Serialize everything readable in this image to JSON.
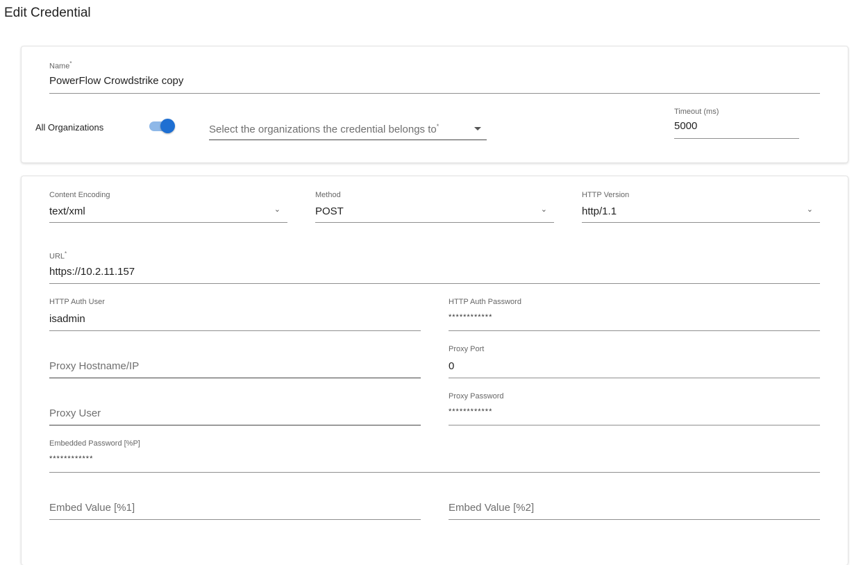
{
  "page": {
    "title": "Edit Credential"
  },
  "general": {
    "name": {
      "label": "Name",
      "required_mark": "*",
      "value": "PowerFlow Crowdstrike copy"
    },
    "all_orgs": {
      "label": "All Organizations",
      "enabled": true
    },
    "organizations": {
      "placeholder": "Select the organizations the credential belongs to",
      "required_mark": "*"
    },
    "timeout": {
      "label": "Timeout (ms)",
      "value": "5000"
    }
  },
  "connection": {
    "content_encoding": {
      "label": "Content Encoding",
      "value": "text/xml"
    },
    "method": {
      "label": "Method",
      "value": "POST"
    },
    "http_version": {
      "label": "HTTP Version",
      "value": "http/1.1"
    },
    "url": {
      "label": "URL",
      "required_mark": "*",
      "value": "https://10.2.11.157"
    },
    "auth_user": {
      "label": "HTTP Auth User",
      "value": "isadmin"
    },
    "auth_password": {
      "label": "HTTP Auth Password",
      "value": "************"
    },
    "proxy_host": {
      "placeholder": "Proxy Hostname/IP"
    },
    "proxy_port": {
      "label": "Proxy Port",
      "value": "0"
    },
    "proxy_user": {
      "placeholder": "Proxy User"
    },
    "proxy_password": {
      "label": "Proxy Password",
      "value": "************"
    },
    "embedded_password": {
      "label": "Embedded Password [%P]",
      "value": "************"
    },
    "embed_value_1": {
      "placeholder": "Embed Value [%1]"
    },
    "embed_value_2": {
      "placeholder": "Embed Value [%2]"
    }
  },
  "icons": {
    "select_chevron": "⌄",
    "toggle_on": "toggle-on-icon"
  },
  "colors": {
    "accent": "#1e6fd2",
    "toggle_track": "#8eb8e8"
  }
}
